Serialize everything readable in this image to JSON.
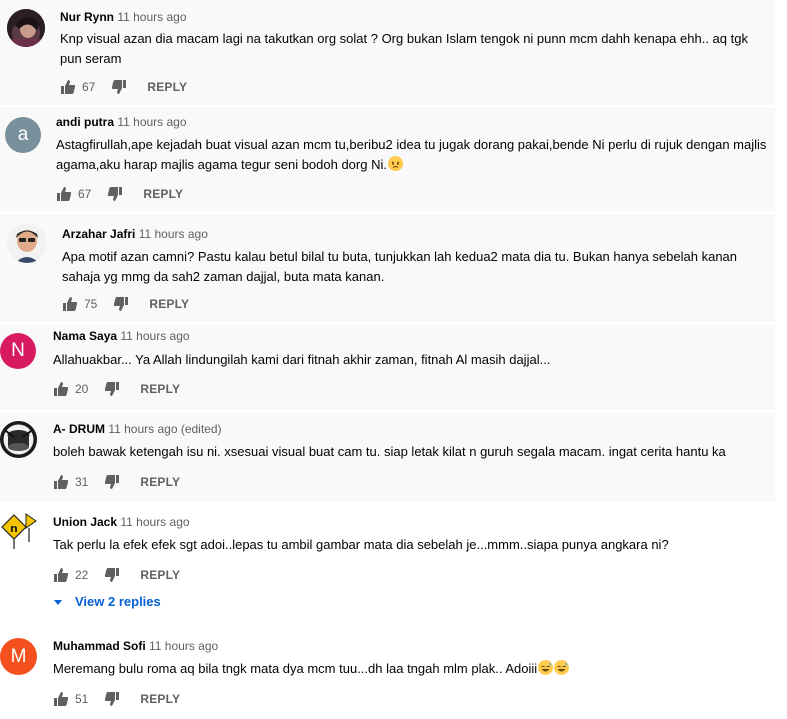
{
  "comments": [
    {
      "author": "Nur Rynn",
      "time": "11 hours ago",
      "text": "Knp visual azan dia macam lagi na takutkan org solat ? Org bukan Islam tengok ni punn mcm dahh kenapa ehh.. aq tgk pun seram",
      "likes": "67",
      "reply": "REPLY",
      "avatar": "photo-avatar"
    },
    {
      "author": "andi putra",
      "time": "11 hours ago",
      "text": "Astagfirullah,ape kejadah buat visual azan mcm tu,beribu2 idea tu jugak dorang pakai,bende Ni perlu di rujuk dengan majlis agama,aku harap majlis agama tegur seni bodoh dorg Ni.",
      "likes": "67",
      "reply": "REPLY",
      "avatar_letter": "a",
      "avatar_color": "#78909c"
    },
    {
      "author": "Arzahar Jafri",
      "time": "11 hours ago",
      "text": "Apa motif azan camni?  Pastu kalau betul bilal tu buta,  tunjukkan lah kedua2 mata dia tu.  Bukan hanya sebelah kanan sahaja yg mmg da sah2 zaman dajjal, buta mata kanan.",
      "likes": "75",
      "reply": "REPLY",
      "avatar": "cartoon-avatar"
    },
    {
      "author": "Nama Saya",
      "time": "11 hours ago",
      "text": "Allahuakbar... Ya Allah lindungilah kami dari fitnah akhir zaman, fitnah Al masih dajjal...",
      "likes": "20",
      "reply": "REPLY",
      "avatar_letter": "N",
      "avatar_color": "#d81b60"
    },
    {
      "author": "A- DRUM",
      "time": "11 hours ago (edited)",
      "text": "boleh bawak ketengah isu ni. xsesuai visual buat cam tu. siap letak kilat n guruh segala macam. ingat cerita hantu ka",
      "likes": "31",
      "reply": "REPLY",
      "avatar": "drum-avatar"
    },
    {
      "author": "Union Jack",
      "time": "11 hours ago",
      "text": "Tak perlu la efek efek sgt adoi..lepas tu ambil gambar mata dia sebelah je...mmm..siapa punya angkara ni?",
      "likes": "22",
      "reply": "REPLY",
      "avatar": "road-sign-avatar",
      "view_replies": "View 2 replies"
    },
    {
      "author": "Muhammad Sofi",
      "time": "11 hours ago",
      "text": "Meremang bulu roma aq bila tngk mata dya mcm tuu...dh laa tngah mlm plak.. Adoiii",
      "likes": "51",
      "reply": "REPLY",
      "avatar_letter": "M",
      "avatar_color": "#f4511e"
    }
  ],
  "colors": {
    "text": "#030303",
    "secondary": "#606060",
    "link": "#065fd4",
    "alt_row": "#f9f9f9"
  }
}
